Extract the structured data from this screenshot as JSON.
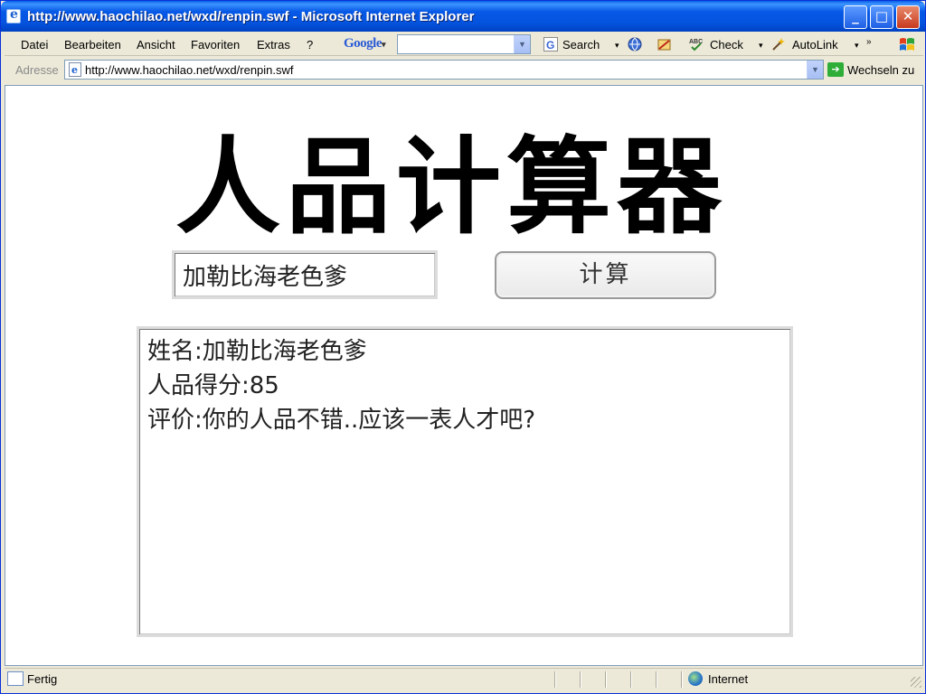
{
  "window": {
    "title": "http://www.haochilao.net/wxd/renpin.swf - Microsoft Internet Explorer",
    "minimize": "_",
    "maximize": "□",
    "close": "✕"
  },
  "menu": {
    "items": [
      "Datei",
      "Bearbeiten",
      "Ansicht",
      "Favoriten",
      "Extras",
      "?"
    ],
    "google_logo": "Google",
    "search_label": "Search",
    "check_label": "Check",
    "autolink_label": "AutoLink",
    "more_label": "»"
  },
  "address": {
    "label": "Adresse",
    "url": "http://www.haochilao.net/wxd/renpin.swf",
    "go_label": "Wechseln zu"
  },
  "page": {
    "title": "人品计算器",
    "name_value": "加勒比海老色爹",
    "button_label": "计算",
    "result_lines": [
      "姓名:加勒比海老色爹",
      "人品得分:85",
      "评价:你的人品不错..应该一表人才吧?"
    ]
  },
  "status": {
    "text": "Fertig",
    "zone": "Internet"
  },
  "colors": {
    "titlebar": "#0554e0",
    "chrome": "#ece9d8",
    "content_bg": "#ffffff"
  }
}
